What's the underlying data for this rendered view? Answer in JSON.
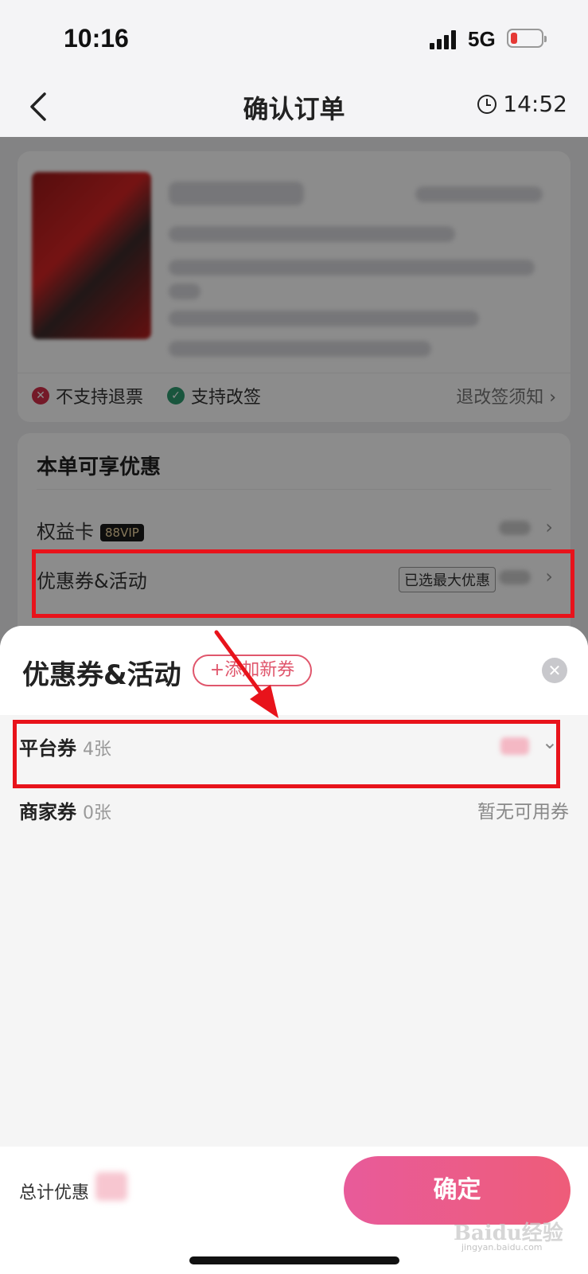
{
  "status_bar": {
    "time": "10:16",
    "network": "5G"
  },
  "nav": {
    "title": "确认订单",
    "countdown": "14:52"
  },
  "order_card": {
    "policies": [
      {
        "label": "不支持退票",
        "icon": "x-circle-icon",
        "supported": false
      },
      {
        "label": "支持改签",
        "icon": "check-circle-icon",
        "supported": true
      }
    ],
    "notice_link": "退改签须知 ›"
  },
  "discount_card": {
    "title": "本单可享优惠",
    "rights_card_label": "权益卡",
    "vip_badge": "88VIP",
    "coupons_label": "优惠券&活动",
    "max_discount_tag": "已选最大优惠"
  },
  "sheet": {
    "title": "优惠券&活动",
    "add_button": "+添加新券",
    "rows": [
      {
        "name": "平台券",
        "count": "4张"
      },
      {
        "name": "商家券",
        "count": "0张",
        "status": "暂无可用券"
      }
    ]
  },
  "footer": {
    "total_label": "总计优惠",
    "confirm_button": "确定"
  },
  "watermark": {
    "text": "Baidu经验",
    "sub": "jingyan.baidu.com"
  },
  "colors": {
    "accent_pink": "#e85b9a",
    "highlight_red": "#e8131b"
  }
}
